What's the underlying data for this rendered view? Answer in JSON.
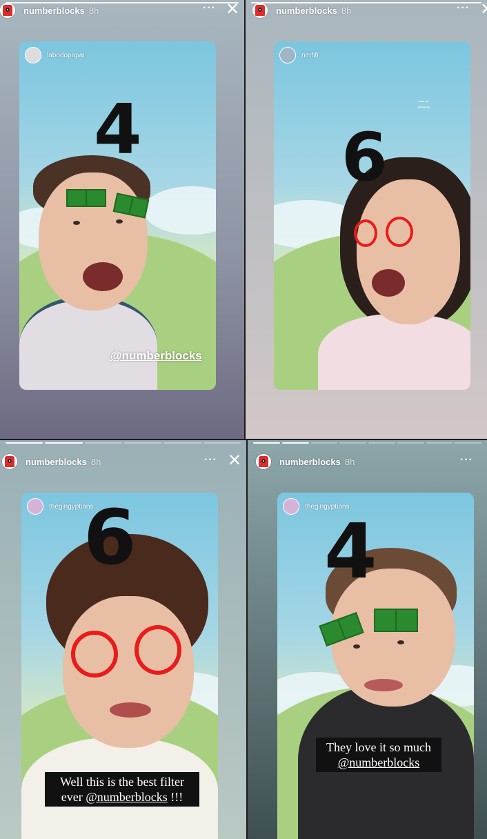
{
  "stories": [
    {
      "account": "numberblocks",
      "time": "8h",
      "more_label": "···",
      "close_label": "✕",
      "repost_user": "labodopapai",
      "number": "4",
      "mention": "@numberblocks"
    },
    {
      "account": "numberblocks",
      "time": "8h",
      "more_label": "···",
      "close_label": "✕",
      "repost_user": "nerfifi",
      "number": "6"
    },
    {
      "account": "numberblocks",
      "time": "8h",
      "more_label": "···",
      "close_label": "✕",
      "repost_user": "thegingyptians",
      "number": "6",
      "caption_line1": "Well this is the best filter",
      "caption_line2_prefix": "ever ",
      "caption_mention": "@numberblocks",
      "caption_line2_suffix": " !!!"
    },
    {
      "account": "numberblocks",
      "time": "8h",
      "more_label": "···",
      "close_label": "✕",
      "repost_user": "thegingyptians",
      "number": "4",
      "caption_line1": "They love it so much",
      "caption_mention": "@numberblocks"
    }
  ],
  "colors": {
    "brow_green": "#2a8a2e",
    "ring_red": "#e81c1c",
    "logo_red": "#e32a2a"
  },
  "icons": [
    "numberblocks-avatar-icon",
    "more-options-icon",
    "close-icon"
  ]
}
